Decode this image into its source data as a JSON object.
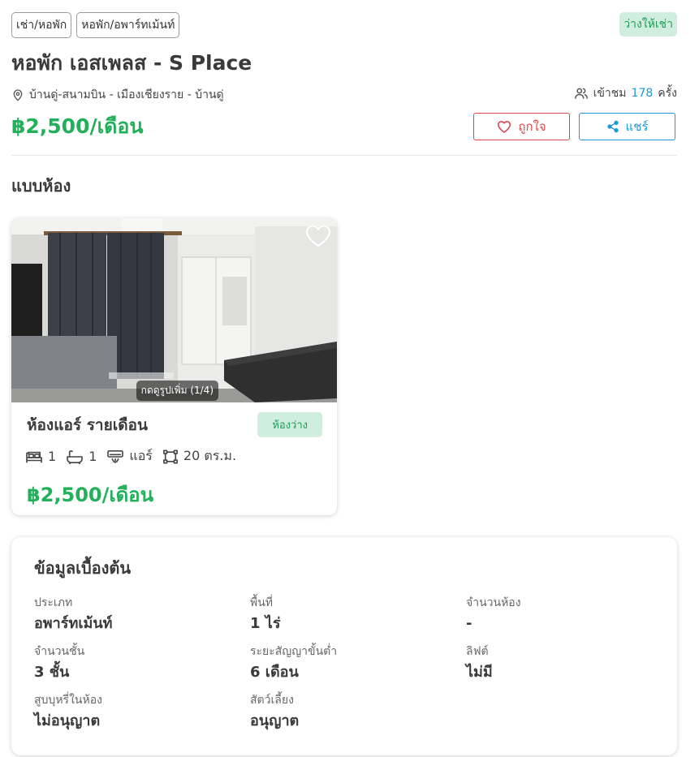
{
  "tags": [
    "เช่า/หอพัก",
    "หอพัก/อพาร์ทเม้นท์"
  ],
  "availability": "ว่างให้เช่า",
  "title": "หอพัก เอสเพลส - S Place",
  "location": {
    "icon": "map-pin-icon",
    "text": "บ้านดู่-สนามบิน - เมืองเชียงราย - บ้านดู่"
  },
  "views": {
    "icon": "users-icon",
    "prefix": "เข้าชม",
    "count": "178",
    "suffix": "ครั้ง"
  },
  "price": "฿2,500/เดือน",
  "actions": {
    "like_label": "ถูกใจ",
    "like_icon": "heart-icon",
    "share_label": "แชร์",
    "share_icon": "share-icon"
  },
  "room_types_heading": "แบบห้อง",
  "room": {
    "photo_count_label": "กดดูรูปเพิ่ม (1/4)",
    "name": "ห้องแอร์ รายเดือน",
    "status": "ห้องว่าง",
    "bedrooms": "1",
    "bathrooms": "1",
    "aircon": "แอร์",
    "area": "20 ตร.ม.",
    "price": "฿2,500/เดือน"
  },
  "basic_info": {
    "title": "ข้อมูลเบื้องต้น",
    "items": [
      {
        "label": "ประเภท",
        "value": "อพาร์ทเม้นท์"
      },
      {
        "label": "พื้นที่",
        "value": "1 ไร่"
      },
      {
        "label": "จำนวนห้อง",
        "value": "-"
      },
      {
        "label": "จำนวนชั้น",
        "value": "3 ชั้น"
      },
      {
        "label": "ระยะสัญญาขั้นต่ำ",
        "value": "6 เดือน"
      },
      {
        "label": "ลิฟต์",
        "value": "ไม่มี"
      },
      {
        "label": "สูบบุหรี่ในห้อง",
        "value": "ไม่อนุญาต"
      },
      {
        "label": "สัตว์เลี้ยง",
        "value": "อนุญาต"
      }
    ]
  },
  "colors": {
    "green": "#22b05b",
    "blue": "#1a9ad6",
    "red": "#e0464e",
    "badge_bg": "#cfeedd"
  }
}
